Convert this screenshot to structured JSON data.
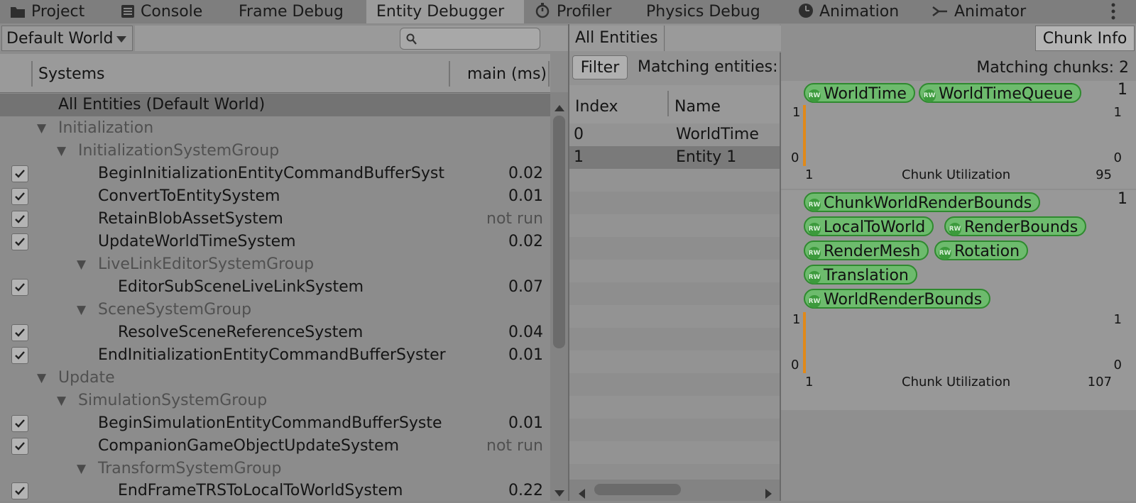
{
  "tabs": [
    {
      "label": "Project",
      "icon": "folder-icon"
    },
    {
      "label": "Console",
      "icon": "console-icon"
    },
    {
      "label": "Frame Debug"
    },
    {
      "label": "Entity Debugger"
    },
    {
      "label": "Profiler",
      "icon": "stopwatch-icon"
    },
    {
      "label": "Physics Debug"
    },
    {
      "label": "Animation",
      "icon": "clock-icon"
    },
    {
      "label": "Animator",
      "icon": "animator-icon"
    }
  ],
  "world_dropdown": "Default World",
  "systems_header": {
    "systems": "Systems",
    "main": "main (ms)"
  },
  "all_entities_row": "All Entities (Default World)",
  "rows": [
    {
      "name": "Initialization",
      "value": ""
    },
    {
      "name": "InitializationSystemGroup",
      "value": ""
    },
    {
      "name": "BeginInitializationEntityCommandBufferSyst",
      "value": "0.02"
    },
    {
      "name": "ConvertToEntitySystem",
      "value": "0.01"
    },
    {
      "name": "RetainBlobAssetSystem",
      "value": "not run"
    },
    {
      "name": "UpdateWorldTimeSystem",
      "value": "0.02"
    },
    {
      "name": "LiveLinkEditorSystemGroup",
      "value": ""
    },
    {
      "name": "EditorSubSceneLiveLinkSystem",
      "value": "0.07"
    },
    {
      "name": "SceneSystemGroup",
      "value": ""
    },
    {
      "name": "ResolveSceneReferenceSystem",
      "value": "0.04"
    },
    {
      "name": "EndInitializationEntityCommandBufferSyster",
      "value": "0.01"
    },
    {
      "name": "Update",
      "value": ""
    },
    {
      "name": "SimulationSystemGroup",
      "value": ""
    },
    {
      "name": "BeginSimulationEntityCommandBufferSyste",
      "value": "0.01"
    },
    {
      "name": "CompanionGameObjectUpdateSystem",
      "value": "not run"
    },
    {
      "name": "TransformSystemGroup",
      "value": ""
    },
    {
      "name": "EndFrameTRSToLocalToWorldSystem",
      "value": "0.22"
    }
  ],
  "entities": {
    "tab": "All Entities",
    "filter": "Filter",
    "matching": "Matching entities:",
    "col_index": "Index",
    "col_name": "Name",
    "rows": [
      {
        "index": "0",
        "name": "WorldTime"
      },
      {
        "index": "1",
        "name": "Entity 1"
      }
    ]
  },
  "chunk_panel": {
    "button": "Chunk Info",
    "matching": "Matching chunks: 2",
    "rw_badge": "RW",
    "chunks": [
      {
        "count": "1",
        "components": [
          "WorldTime",
          "WorldTimeQueue"
        ],
        "ymax_left": "1",
        "ymin_left": "0",
        "ymax_right": "1",
        "ymin_right": "0",
        "x_start": "1",
        "label": "Chunk Utilization",
        "capacity": "95"
      },
      {
        "count": "1",
        "components": [
          "ChunkWorldRenderBounds",
          "LocalToWorld",
          "RenderBounds",
          "RenderMesh",
          "Rotation",
          "Translation",
          "WorldRenderBounds"
        ],
        "ymax_left": "1",
        "ymin_left": "0",
        "ymax_right": "1",
        "ymin_right": "0",
        "x_start": "1",
        "label": "Chunk Utilization",
        "capacity": "107"
      }
    ]
  }
}
